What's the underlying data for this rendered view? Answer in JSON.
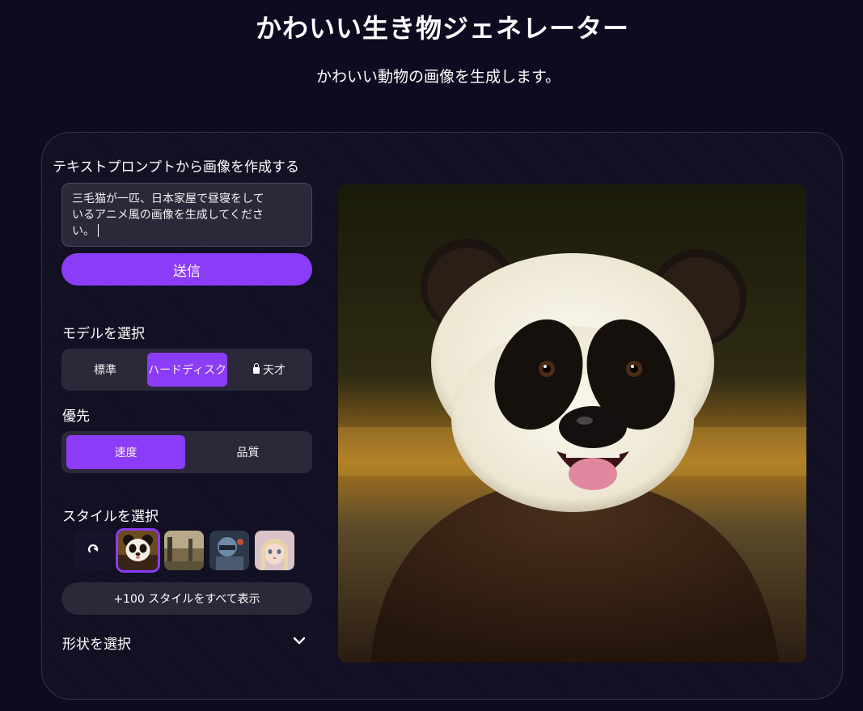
{
  "header": {
    "title": "かわいい生き物ジェネレーター",
    "subtitle": "かわいい動物の画像を生成します。"
  },
  "prompt_section": {
    "heading": "テキストプロンプトから画像を作成する",
    "prompt_line1": "三毛猫が一匹、日本家屋で昼寝をして",
    "prompt_line2": "いるアニメ風の画像を生成してくださ",
    "prompt_line3": "い。",
    "send_label": "送信"
  },
  "model": {
    "heading": "モデルを選択",
    "options": [
      "標準",
      "ハードディスク",
      "天才"
    ],
    "selected": "ハードディスク"
  },
  "priority": {
    "heading": "優先",
    "options": [
      "速度",
      "品質"
    ],
    "selected": "速度"
  },
  "style": {
    "heading": "スタイルを選択",
    "thumbnails": [
      "none-style",
      "panda-style",
      "landscape-style",
      "robot-style",
      "anime-girl-style"
    ],
    "selected": "panda-style",
    "show_all_label": "+100 スタイルをすべて表示"
  },
  "shape": {
    "heading": "形状を選択"
  },
  "colors": {
    "accent": "#8b3cf6",
    "background": "#0d0b1f",
    "panel": "#2a2839"
  },
  "result": {
    "image_subject": "panda"
  }
}
